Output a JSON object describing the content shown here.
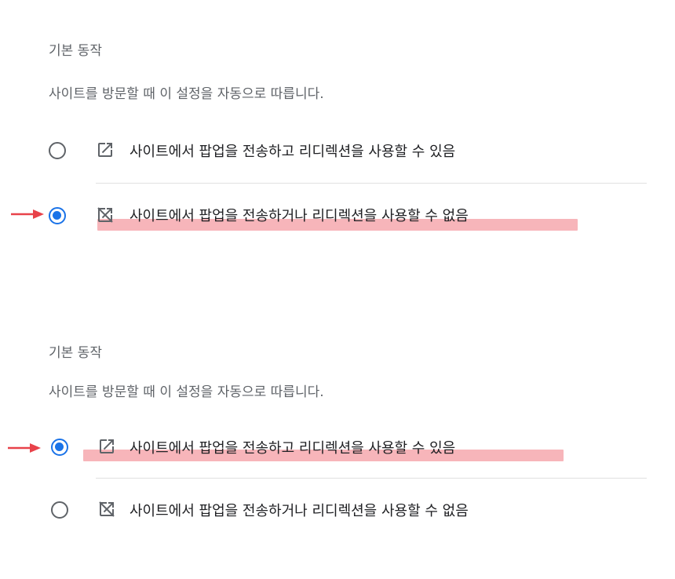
{
  "panels": [
    {
      "heading": "기본 동작",
      "description": "사이트를 방문할 때 이 설정을 자동으로 따릅니다.",
      "options": [
        {
          "label": "사이트에서 팝업을 전송하고 리디렉션을 사용할 수 있음",
          "icon": "open-in-new-icon",
          "checked": false
        },
        {
          "label": "사이트에서 팝업을 전송하거나 리디렉션을 사용할 수 없음",
          "icon": "open-in-new-off-icon",
          "checked": true
        }
      ]
    },
    {
      "heading": "기본 동작",
      "description": "사이트를 방문할 때 이 설정을 자동으로 따릅니다.",
      "options": [
        {
          "label": "사이트에서 팝업을 전송하고 리디렉션을 사용할 수 있음",
          "icon": "open-in-new-icon",
          "checked": true
        },
        {
          "label": "사이트에서 팝업을 전송하거나 리디렉션을 사용할 수 없음",
          "icon": "open-in-new-off-icon",
          "checked": false
        }
      ]
    }
  ],
  "colors": {
    "accent": "#1a73e8",
    "annotation_arrow": "#e8424a",
    "annotation_highlight": "#f07882"
  }
}
